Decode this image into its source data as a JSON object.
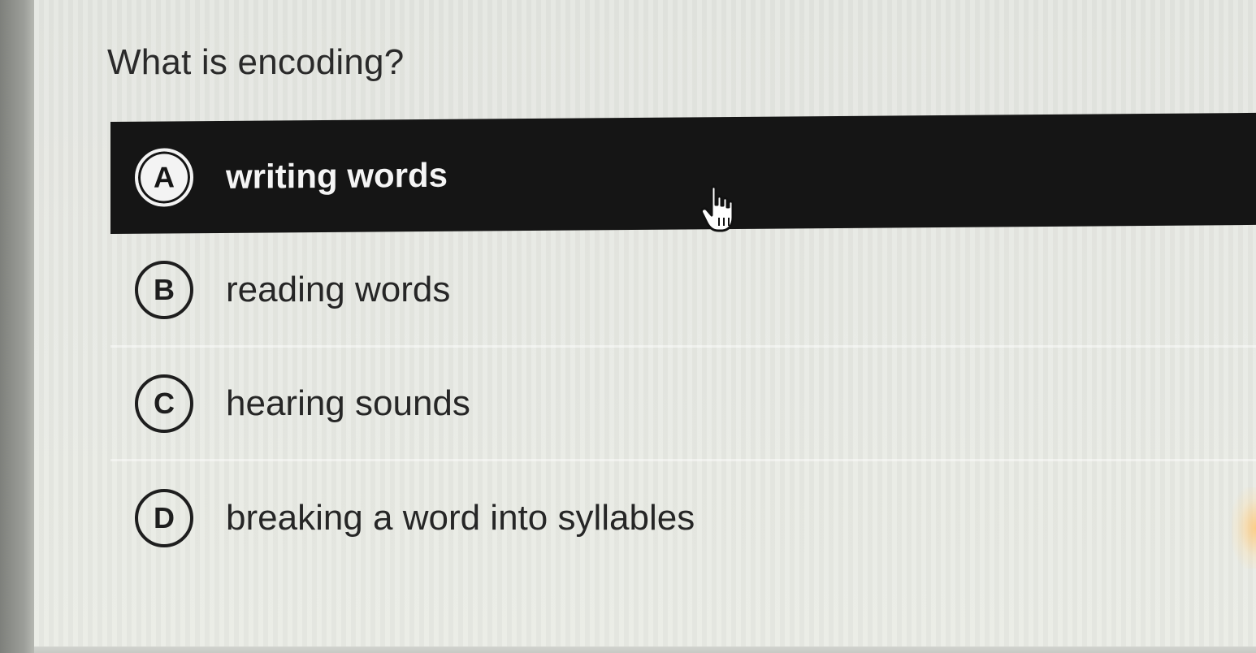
{
  "question": {
    "text": "What is encoding?"
  },
  "choices": [
    {
      "letter": "A",
      "label": "writing words",
      "selected": true
    },
    {
      "letter": "B",
      "label": "reading words",
      "selected": false
    },
    {
      "letter": "C",
      "label": "hearing sounds",
      "selected": false
    },
    {
      "letter": "D",
      "label": "breaking a word into syllables",
      "selected": false
    }
  ],
  "cursor": {
    "icon": "hand-pointer-icon"
  },
  "colors": {
    "selected_background": "#151515",
    "selected_text": "#f5f5f5",
    "page_background": "#e6e8e2",
    "text": "#262626"
  }
}
